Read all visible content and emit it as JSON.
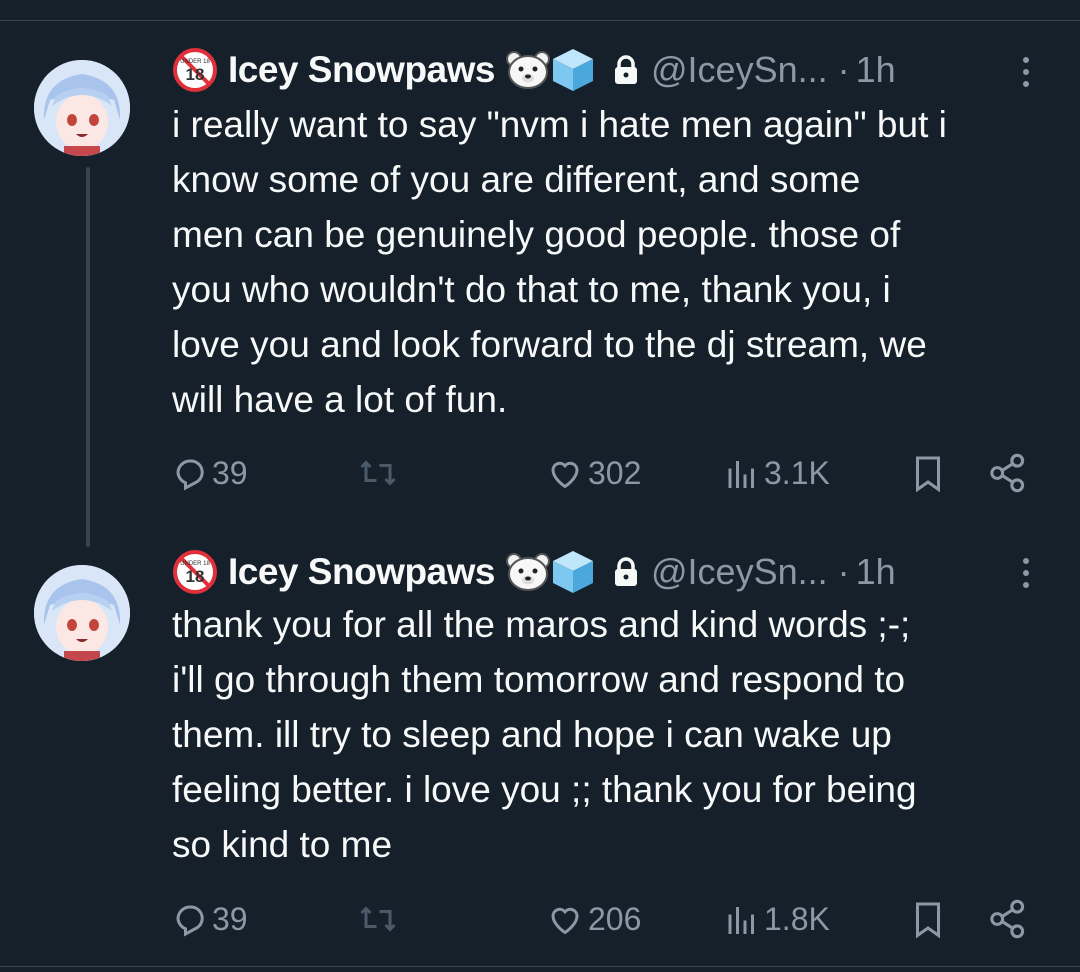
{
  "tweets": [
    {
      "display_name": "Icey Snowpaws",
      "handle": "@IceySn...",
      "time": "1h",
      "text": "i really want to say \"nvm i hate men again\" but i\nknow some of you are different, and some\nmen can be genuinely good people. those of\nyou who wouldn't do that to me, thank you, i\nlove you and look forward to the dj stream, we\nwill have a lot of fun.",
      "replies": "39",
      "retweets": "",
      "likes": "302",
      "views": "3.1K"
    },
    {
      "display_name": "Icey Snowpaws",
      "handle": "@IceySn...",
      "time": "1h",
      "text": "thank you for all the maros and kind words ;-;\ni'll go through them tomorrow and respond to\nthem. ill try to sleep and hope i can wake up\nfeeling better. i love you ;; thank you for being\nso kind to me",
      "replies": "39",
      "retweets": "",
      "likes": "206",
      "views": "1.8K"
    }
  ],
  "badge_text": "UNDER 18",
  "icons": [
    "under-18-icon",
    "polar-bear-icon",
    "ice-cube-icon",
    "lock-icon",
    "more-icon",
    "reply-icon",
    "retweet-icon",
    "like-icon",
    "views-icon",
    "bookmark-icon",
    "share-icon"
  ],
  "colors": {
    "background": "#15202b",
    "text": "#f7f9f9",
    "secondary": "#8b98a5",
    "divider": "#38444d"
  }
}
